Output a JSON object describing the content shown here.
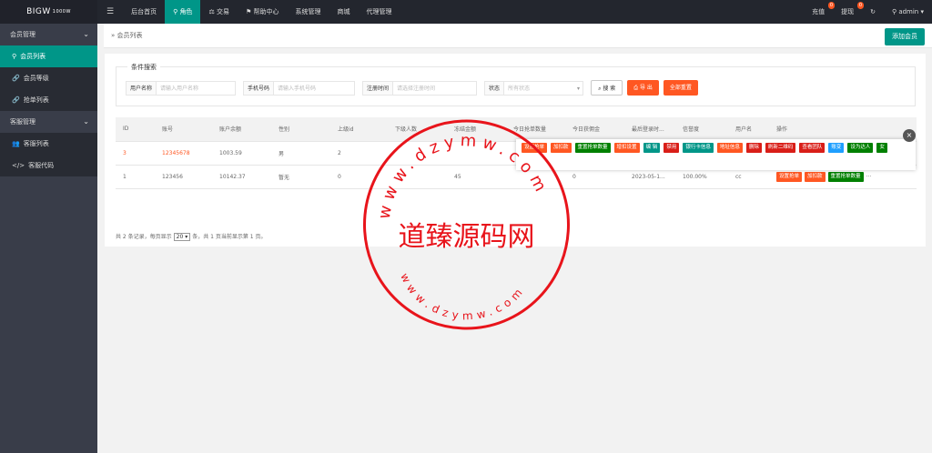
{
  "app": {
    "logo": "BIGW",
    "logo_sup": "1000W"
  },
  "nav": {
    "menu_icon": "☰",
    "items": [
      {
        "label": "后台首页"
      },
      {
        "label": "角色",
        "icon": "user-icon",
        "active": true
      },
      {
        "label": "交易",
        "icon": "scale-icon"
      },
      {
        "label": "帮助中心",
        "icon": "flag-icon"
      },
      {
        "label": "系统管理"
      },
      {
        "label": "商城"
      },
      {
        "label": "代理管理"
      }
    ]
  },
  "topright": {
    "recharge_label": "充值",
    "recharge_badge": "0",
    "withdraw_label": "提现",
    "withdraw_badge": "0",
    "refresh_icon": "refresh-icon",
    "user_label": "admin"
  },
  "sidebar": {
    "group1": "会员管理",
    "items1": [
      "会员列表",
      "会员等级",
      "抢单列表"
    ],
    "group2": "客服管理",
    "items2": [
      "客服列表",
      "客服代码"
    ]
  },
  "breadcrumb": {
    "label": "会员列表",
    "add_button": "添加会员"
  },
  "search": {
    "legend": "条件搜索",
    "username_label": "用户名称",
    "username_placeholder": "请输入用户名称",
    "phone_label": "手机号码",
    "phone_placeholder": "请输入手机号码",
    "regtime_label": "注册时间",
    "regtime_placeholder": "请选择注册时间",
    "status_label": "状态",
    "status_value": "所有状态",
    "search_button": "搜 索",
    "export_button": "导 出",
    "reset_button": "全部重置"
  },
  "table": {
    "columns": [
      "ID",
      "账号",
      "账户余额",
      "性别",
      "上级id",
      "下级人数",
      "冻结金额",
      "今日抢单数量",
      "今日获佣金",
      "最后登录时...",
      "信誉度",
      "用户名",
      "操作"
    ],
    "rows": [
      {
        "id": "3",
        "account": "12345678",
        "balance": "1003.59",
        "gender": "男",
        "parent": "2",
        "sub": "",
        "frozen": "",
        "today_orders": "",
        "today_comm": "",
        "last_login": "",
        "credit": "",
        "username": ""
      },
      {
        "id": "1",
        "account": "123456",
        "balance": "10142.37",
        "gender": "暂无",
        "parent": "0",
        "sub": "",
        "frozen": "45",
        "today_orders": "",
        "today_comm": "0",
        "last_login": "2023-05-1...",
        "credit": "100.00%",
        "username": "cc"
      }
    ],
    "ops_row1": [
      {
        "label": "设置抢单",
        "color": "orange"
      },
      {
        "label": "加扣款",
        "color": "orange"
      },
      {
        "label": "重置抢单数量",
        "color": "dgreen"
      },
      {
        "label": "增扣设置",
        "color": "orange"
      },
      {
        "label": "编 辑",
        "color": "green"
      },
      {
        "label": "禁用",
        "color": "red"
      },
      {
        "label": "银行卡信息",
        "color": "green"
      },
      {
        "label": "地址信息",
        "color": "orange"
      },
      {
        "label": "删除",
        "color": "red"
      },
      {
        "label": "刷新二维码",
        "color": "red"
      },
      {
        "label": "查看团队",
        "color": "red"
      },
      {
        "label": "账变",
        "color": "blue"
      },
      {
        "label": "设为达人",
        "color": "dgreen"
      },
      {
        "label": "女",
        "color": "dgreen"
      }
    ],
    "ops_row2": [
      {
        "label": "设置抢单",
        "color": "orange"
      },
      {
        "label": "加扣款",
        "color": "orange"
      },
      {
        "label": "重置抢单数量",
        "color": "dgreen"
      }
    ],
    "ops_row2_more": "..."
  },
  "pager": {
    "text_before": "共 2 条记录，每页显示",
    "page_size": "20",
    "text_after": "条，共 1 页当前显示第 1 页。"
  },
  "watermark": {
    "center_text": "道臻源码网",
    "top_ring": "www.dzymw.com",
    "bottom_ring": "www.dzymw.com"
  }
}
